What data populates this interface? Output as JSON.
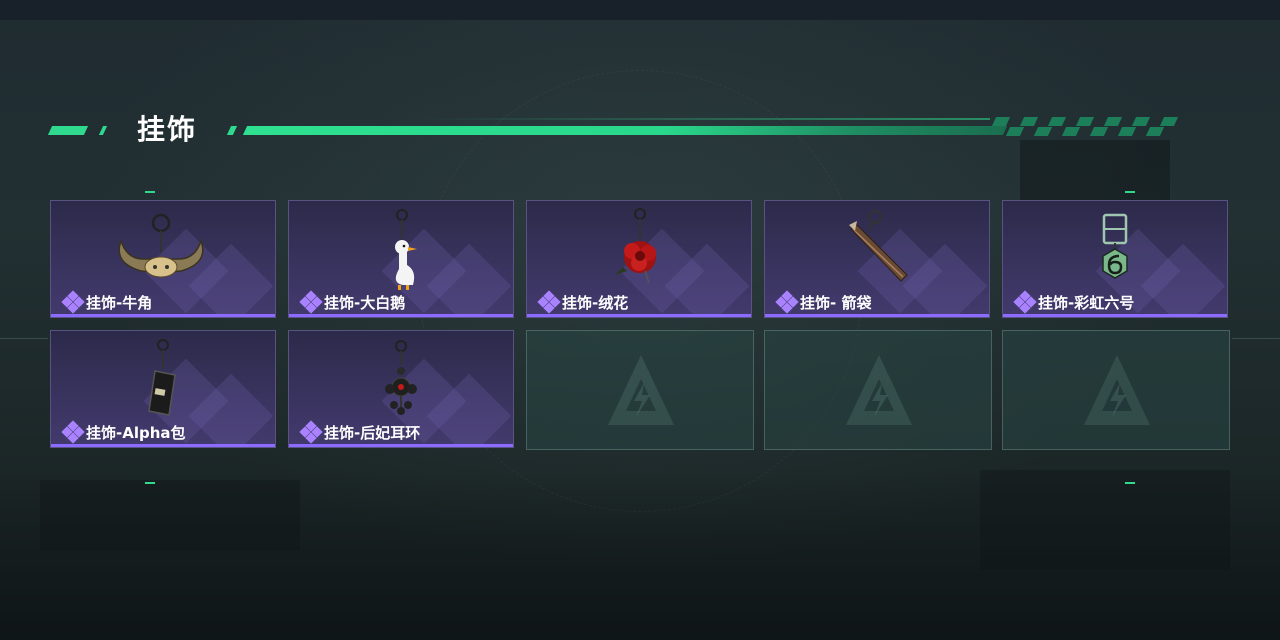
{
  "section": {
    "title": "挂饰"
  },
  "colors": {
    "accent": "#2fd98e",
    "card_bottom": "#8b6cff",
    "rarity": "#a982ff"
  },
  "items": [
    {
      "label": "挂饰-牛角",
      "icon": "bull-horn-charm-icon"
    },
    {
      "label": "挂饰-大白鹅",
      "icon": "white-goose-charm-icon"
    },
    {
      "label": "挂饰-绒花",
      "icon": "velvet-flower-charm-icon"
    },
    {
      "label": "挂饰- 箭袋",
      "icon": "quiver-charm-icon"
    },
    {
      "label": "挂饰-彩虹六号",
      "icon": "rainbow-six-charm-icon"
    },
    {
      "label": "挂饰-Alpha包",
      "icon": "alpha-bag-charm-icon"
    },
    {
      "label": "挂饰-后妃耳环",
      "icon": "consort-earring-charm-icon"
    }
  ],
  "empty_slots": 3
}
